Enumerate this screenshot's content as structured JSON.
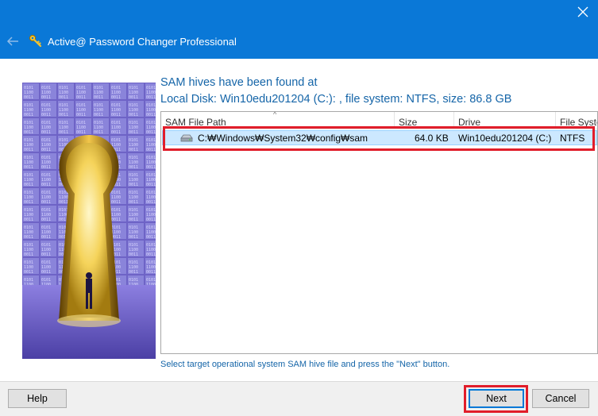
{
  "window": {
    "title": "Active@ Password Changer Professional",
    "accent": "#0a78d7"
  },
  "main": {
    "heading_line1": "SAM hives have been found at",
    "heading_line2": "Local Disk: Win10edu201204 (C:): , file system: NTFS, size: 86.8 GB",
    "hint": "Select target operational system SAM hive file and press the \"Next\" button."
  },
  "table": {
    "columns": [
      "SAM File Path",
      "Size",
      "Drive",
      "File System"
    ],
    "rows": [
      {
        "path": "C:₩Windows₩System32₩config₩sam",
        "size": "64.0 KB",
        "drive": "Win10edu201204 (C:)",
        "fs": "NTFS"
      }
    ]
  },
  "buttons": {
    "help": "Help",
    "next": "Next",
    "cancel": "Cancel"
  },
  "icons": {
    "close": "close-icon",
    "back": "back-arrow-icon",
    "app": "key-icon",
    "drive": "hard-drive-icon"
  },
  "colors": {
    "selection": "#cce8ff",
    "annotation": "#e11d2a",
    "heading_text": "#1565a8"
  }
}
